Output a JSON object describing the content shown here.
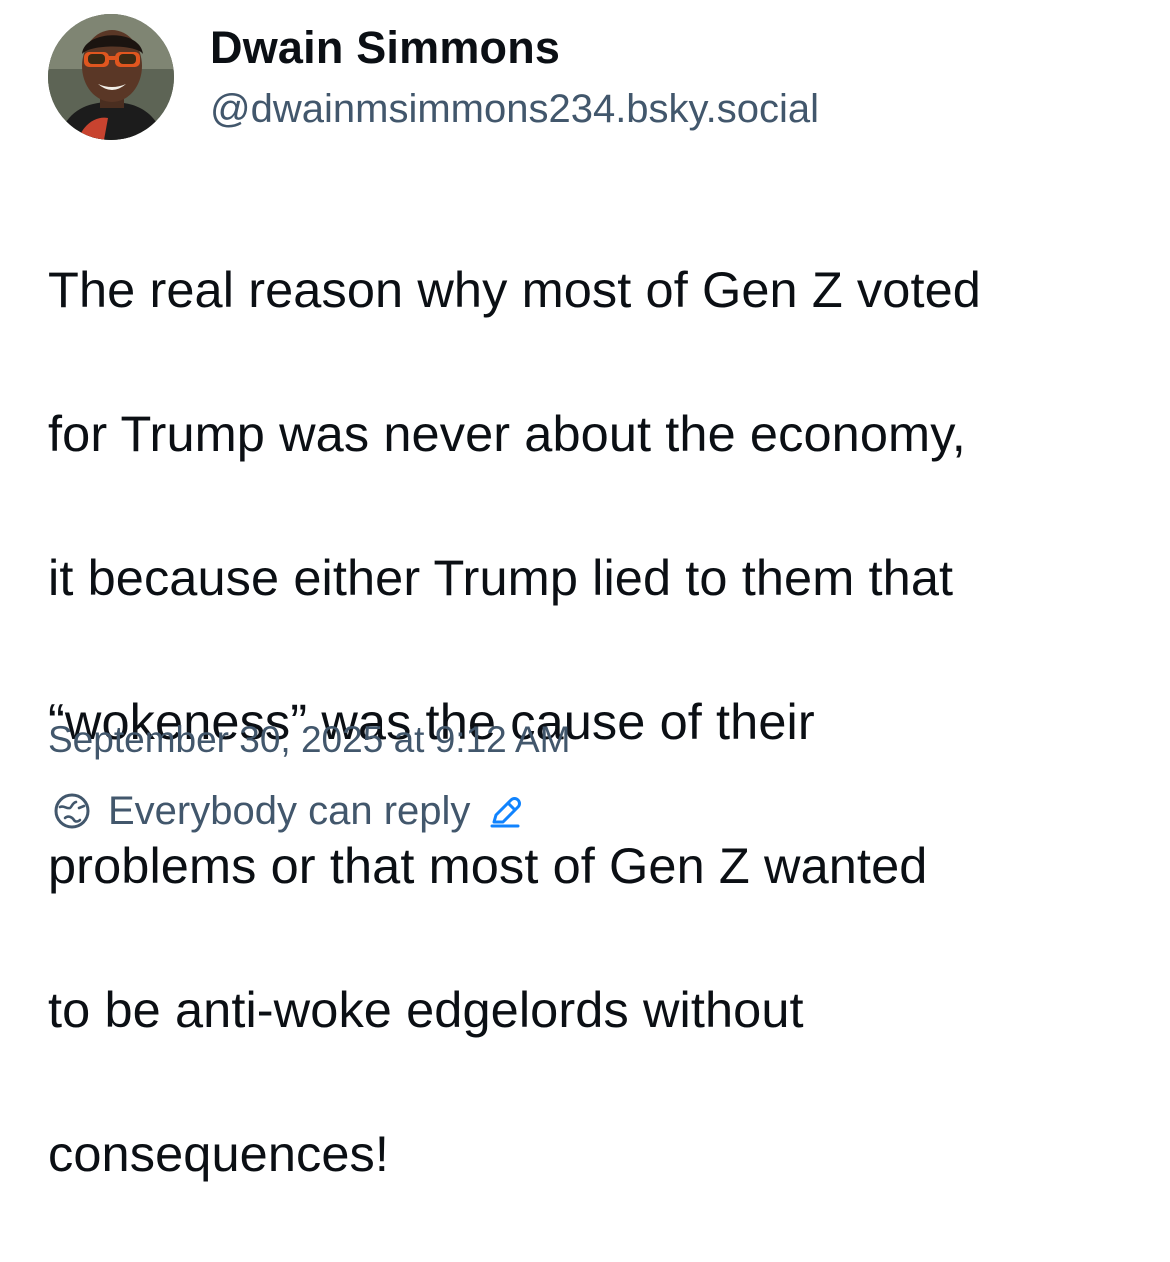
{
  "post": {
    "author": {
      "display_name": "Dwain Simmons",
      "handle": "@dwainmsimmons234.bsky.social"
    },
    "text_lines": [
      "The real reason why most of Gen Z voted",
      "for Trump was never about the economy,",
      "it because either Trump lied to them that",
      "“wokeness” was the cause of their",
      "problems or that most of Gen Z wanted",
      "to be anti-woke edgelords without",
      "consequences!"
    ],
    "timestamp": "September 30, 2025 at 9:12 AM",
    "reply_setting": {
      "label": "Everybody can reply",
      "icon": "globe-reply-icon",
      "edit_icon": "pencil-icon"
    }
  },
  "colors": {
    "text": "#0b0f14",
    "muted": "#42576c",
    "accent": "#1083fe"
  }
}
